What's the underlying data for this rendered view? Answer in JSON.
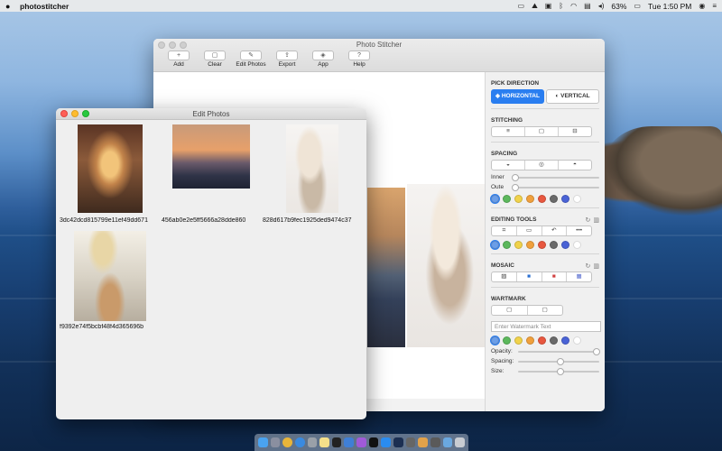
{
  "menubar": {
    "app_name": "photostitcher",
    "battery": "63%",
    "clock": "Tue 1:50 PM"
  },
  "stitcher": {
    "title": "Photo Stitcher",
    "toolbar": [
      {
        "label": "Add",
        "icon": "+"
      },
      {
        "label": "Clear",
        "icon": "▢"
      },
      {
        "label": "Edit Photos",
        "icon": "✎"
      },
      {
        "label": "Export",
        "icon": "⇪"
      },
      {
        "label": "App",
        "icon": "◈"
      },
      {
        "label": "Help",
        "icon": "?"
      }
    ],
    "panel": {
      "pick_direction": "PICK DIRECTION",
      "horizontal": "HORIZONTAL",
      "vertical": "VERTICAL",
      "stitching": "STITCHING",
      "spacing": "SPACING",
      "inner": "Inner",
      "outer": "Oute",
      "editing_tools": "EDITING TOOLS",
      "mosaic": "MOSAIC",
      "warmark": "WARTMARK",
      "watermark_placeholder": "Enter Watermark Text",
      "opacity": "Opacity:",
      "spacing_label": "Spacing:",
      "size": "Size:"
    },
    "colors": [
      "#6b9ee8",
      "#5cb85c",
      "#f0d24a",
      "#f0a03c",
      "#e8573f",
      "#6a6a6a",
      "#4a63d6",
      "#ffffff"
    ],
    "sliders": {
      "inner": 0.0,
      "outer": 0.0,
      "opacity": 1.0,
      "spacing": 0.52,
      "size": 0.52
    }
  },
  "edit_photos": {
    "title": "Edit Photos",
    "photos": [
      {
        "caption": "3dc42dcd815799e11ef49dd671"
      },
      {
        "caption": "456ab0e2e5ff5666a28dde860"
      },
      {
        "caption": "828d617b9fec1925ded9474c37"
      },
      {
        "caption": "f9392e74f5bcbf48f4d365696b"
      }
    ]
  }
}
